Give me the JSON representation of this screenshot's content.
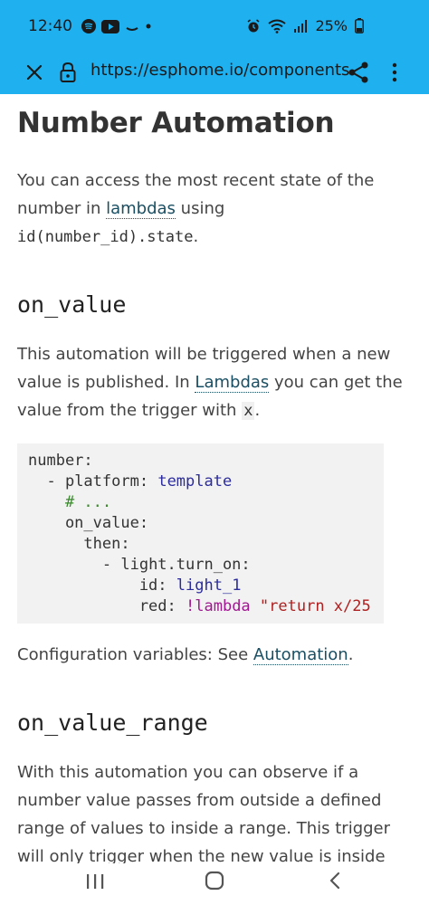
{
  "status_bar": {
    "time": "12:40",
    "battery": "25%",
    "left_icons": [
      "spotify-icon",
      "youtube-icon",
      "cloud-icon",
      "dot-icon"
    ],
    "right_icons": [
      "alarm-icon",
      "wifi-icon",
      "signal-icon",
      "battery-icon"
    ]
  },
  "browser": {
    "url": "https://esphome.io/components",
    "close_icon": "close-icon",
    "lock_icon": "lock-icon",
    "share_icon": "share-icon",
    "more_icon": "more-vert-icon",
    "accent_color": "#1fb0ef"
  },
  "page": {
    "title": "Number Automation",
    "intro_part1": "You can access the most recent state of the number in ",
    "intro_link": "lambdas",
    "intro_part2": " using",
    "intro_code": "id(number_id).state",
    "intro_end": ".",
    "section1_heading": "on_value",
    "section1_part1": "This automation will be triggered when a new value is published. In ",
    "section1_link": "Lambdas",
    "section1_part2": " you can get the value from the trigger with ",
    "section1_code": "x",
    "section1_end": ".",
    "code": {
      "l1_key": "number",
      "l1_colon": ":",
      "l2_dash": "  - ",
      "l2_key": "platform",
      "l2_colon": ": ",
      "l2_val": "template",
      "l3_comment": "    # ...",
      "l4_key": "    on_value",
      "l4_colon": ":",
      "l5_key": "      then",
      "l5_colon": ":",
      "l6_dash": "        - ",
      "l6_key": "light.turn_on",
      "l6_colon": ":",
      "l7_key": "            id",
      "l7_colon": ": ",
      "l7_val": "light_1",
      "l8_key": "            red",
      "l8_colon": ": ",
      "l8_tag": "!lambda",
      "l8_sp": " ",
      "l8_str": "\"return x/25"
    },
    "config_text": "Configuration variables: See ",
    "config_link": "Automation",
    "config_end": ".",
    "section2_heading": "on_value_range",
    "section2_text": "With this automation you can observe if a number value passes from outside a defined range of values to inside a range. This trigger will only trigger when the new value is inside"
  },
  "nav_bar": {
    "recents_icon": "recents-icon",
    "home_icon": "home-icon",
    "back_icon": "back-icon"
  }
}
